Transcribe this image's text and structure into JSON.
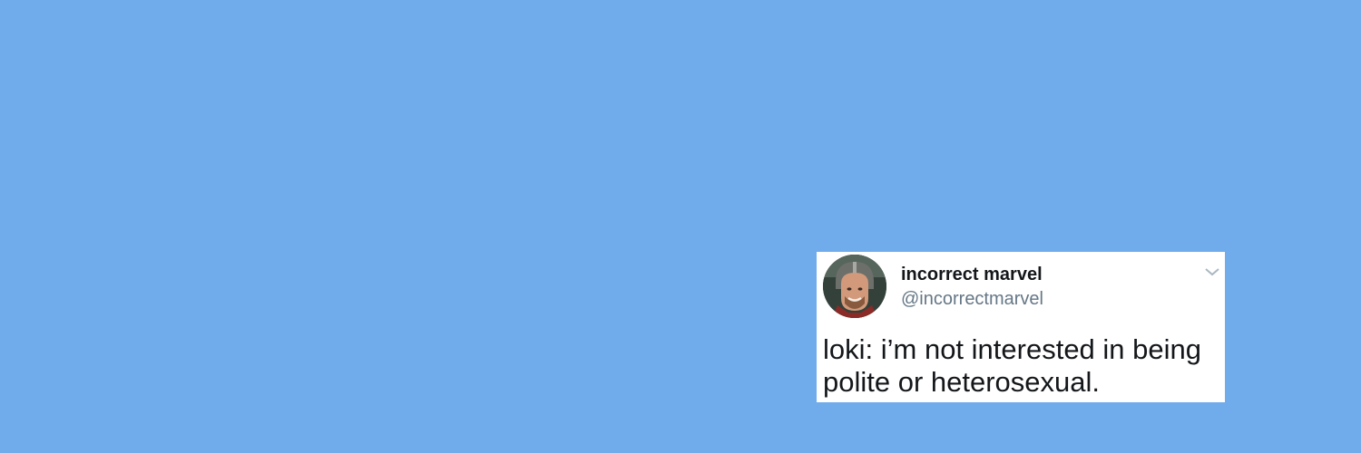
{
  "tweet": {
    "display_name": "incorrect marvel",
    "handle": "@incorrectmarvel",
    "text": "loki: i’m not interested in being polite or heterosexual.",
    "avatar_icon": "profile-photo",
    "menu_icon": "chevron-down-icon"
  },
  "colors": {
    "background": "#70ACEB",
    "card": "#FFFFFF",
    "name_text": "#14171A",
    "handle_text": "#657786",
    "caret": "#AAB8C2"
  }
}
